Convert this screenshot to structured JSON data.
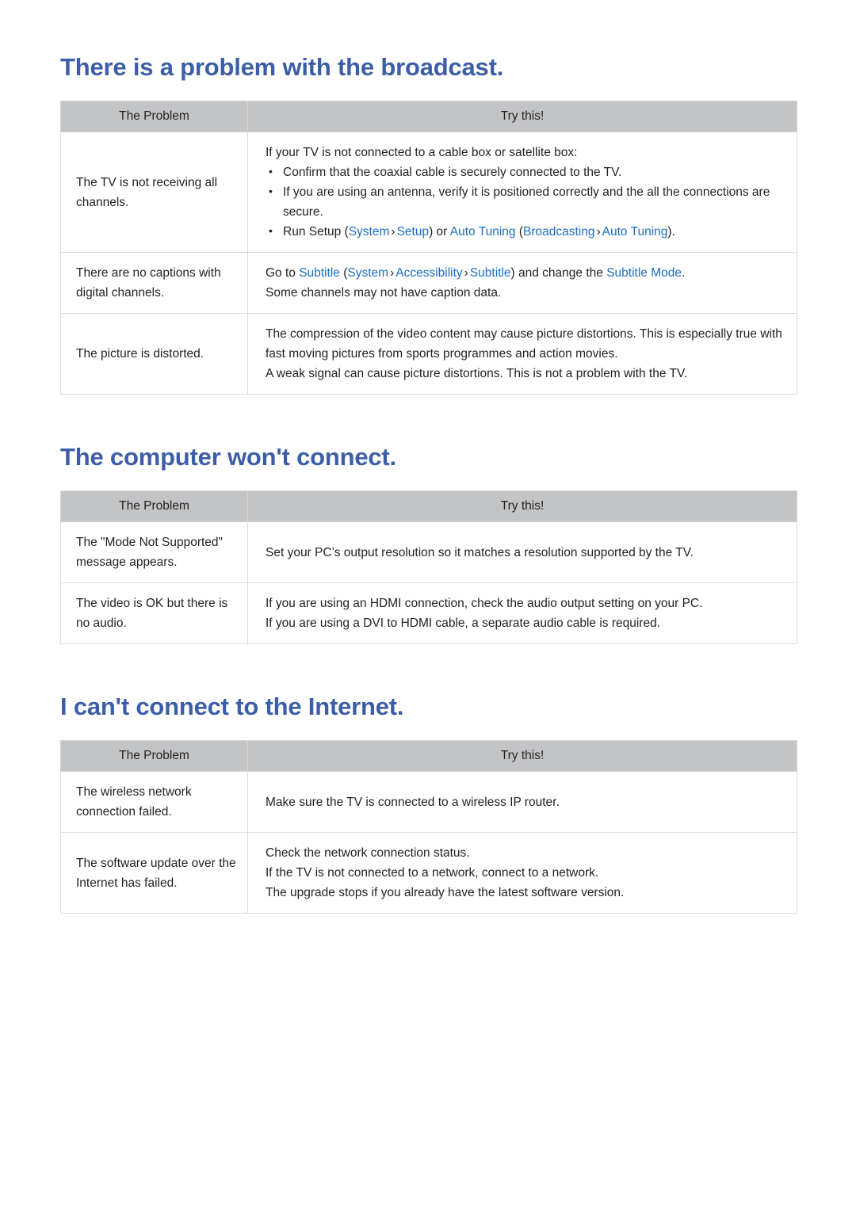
{
  "document": {
    "type": "troubleshooting-guide",
    "heading_color": "#3c5ea8",
    "link_color": "#1a6ec4",
    "header_bg": "#c3c4c6"
  },
  "common": {
    "col_problem": "The Problem",
    "col_try": "Try this!"
  },
  "sections": [
    {
      "id": "broadcast",
      "heading": "There is a problem with the broadcast.",
      "rows": [
        {
          "problem": "The TV is not receiving all channels.",
          "intro": "If your TV is not connected to a cable box or satellite box:",
          "bullets": [
            {
              "text": "Confirm that the coaxial cable is securely connected to the TV."
            },
            {
              "text": "If you are using an antenna, verify it is positioned correctly and the all the connections are secure."
            },
            {
              "parts": [
                {
                  "t": "Run Setup (",
                  "k": "plain"
                },
                {
                  "t": "System",
                  "k": "link"
                },
                {
                  "t": "›",
                  "k": "sep"
                },
                {
                  "t": "Setup",
                  "k": "link"
                },
                {
                  "t": ") or ",
                  "k": "plain"
                },
                {
                  "t": "Auto Tuning",
                  "k": "link"
                },
                {
                  "t": " (",
                  "k": "plain"
                },
                {
                  "t": "Broadcasting",
                  "k": "link"
                },
                {
                  "t": "›",
                  "k": "sep"
                },
                {
                  "t": "Auto Tuning",
                  "k": "link"
                },
                {
                  "t": ").",
                  "k": "plain"
                }
              ]
            }
          ]
        },
        {
          "problem": "There are no captions with digital channels.",
          "lines": [
            {
              "parts": [
                {
                  "t": "Go to ",
                  "k": "plain"
                },
                {
                  "t": "Subtitle",
                  "k": "link"
                },
                {
                  "t": " (",
                  "k": "plain"
                },
                {
                  "t": "System",
                  "k": "link"
                },
                {
                  "t": "›",
                  "k": "sep"
                },
                {
                  "t": "Accessibility",
                  "k": "link"
                },
                {
                  "t": "›",
                  "k": "sep"
                },
                {
                  "t": "Subtitle",
                  "k": "link"
                },
                {
                  "t": ") and change the ",
                  "k": "plain"
                },
                {
                  "t": "Subtitle Mode",
                  "k": "link"
                },
                {
                  "t": ".",
                  "k": "plain"
                }
              ]
            },
            {
              "text": "Some channels may not have caption data."
            }
          ]
        },
        {
          "problem": "The picture is distorted.",
          "lines": [
            {
              "text": "The compression of the video content may cause picture distortions. This is especially true with fast moving pictures from sports programmes and action movies."
            },
            {
              "text": "A weak signal can cause picture distortions. This is not a problem with the TV."
            }
          ]
        }
      ]
    },
    {
      "id": "computer",
      "heading": "The computer won't connect.",
      "rows": [
        {
          "problem": "The \"Mode Not Supported\" message appears.",
          "lines": [
            {
              "text": "Set your PC’s output resolution so it matches a resolution supported by the TV."
            }
          ]
        },
        {
          "problem": "The video is OK but there is no audio.",
          "lines": [
            {
              "text": "If you are using an HDMI connection, check the audio output setting on your PC."
            },
            {
              "text": "If you are using a DVI to HDMI cable, a separate audio cable is required."
            }
          ]
        }
      ]
    },
    {
      "id": "internet",
      "heading": "I can't connect to the Internet.",
      "rows": [
        {
          "problem": "The wireless network connection failed.",
          "lines": [
            {
              "text": "Make sure the TV is connected to a wireless IP router."
            }
          ]
        },
        {
          "problem": "The software update over the Internet has failed.",
          "lines": [
            {
              "text": "Check the network connection status."
            },
            {
              "text": "If the TV is not connected to a network, connect to a network."
            },
            {
              "text": "The upgrade stops if you already have the latest software version."
            }
          ]
        }
      ]
    }
  ]
}
